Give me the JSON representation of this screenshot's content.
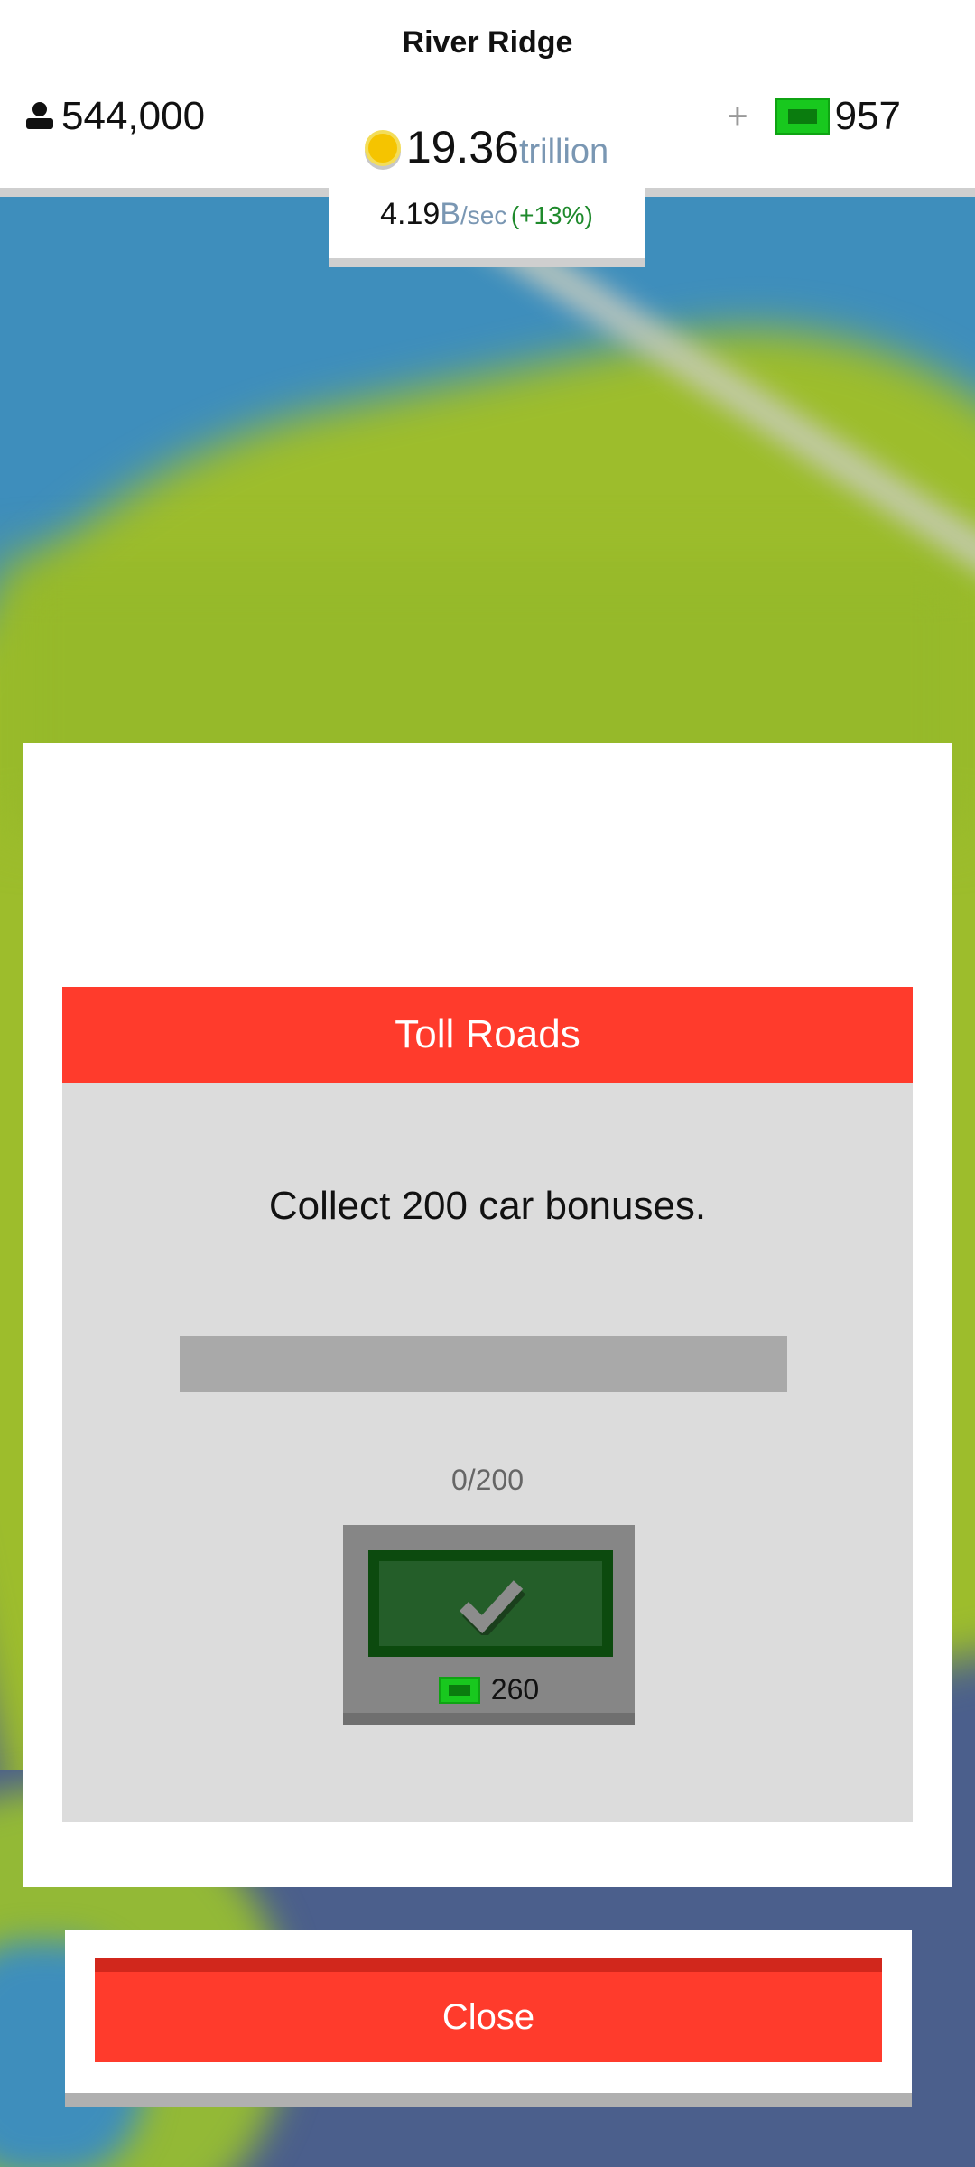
{
  "header": {
    "city_name": "River Ridge",
    "population": "544,000",
    "cash": "957",
    "add_cash_label": "+",
    "coins": {
      "value": "19.36",
      "unit": "trillion"
    },
    "rate": {
      "value": "4.19",
      "unit": "B",
      "per": "/sec",
      "bonus": "(+13%)"
    }
  },
  "modal": {
    "title": "Toll Roads",
    "description": "Collect 200 car bonuses.",
    "progress": {
      "current": 0,
      "target": 200,
      "fraction": 0,
      "text": "0/200"
    },
    "reward": {
      "amount": "260",
      "icon": "cash-bill-icon"
    },
    "claim_icon": "checkmark-icon"
  },
  "close_button": {
    "label": "Close"
  },
  "colors": {
    "accent_red": "#ff3b2c",
    "cash_green": "#18c81e",
    "coin_gold": "#f5c400",
    "unit_blue": "#7a97b3",
    "bonus_green": "#1f8a2c"
  }
}
